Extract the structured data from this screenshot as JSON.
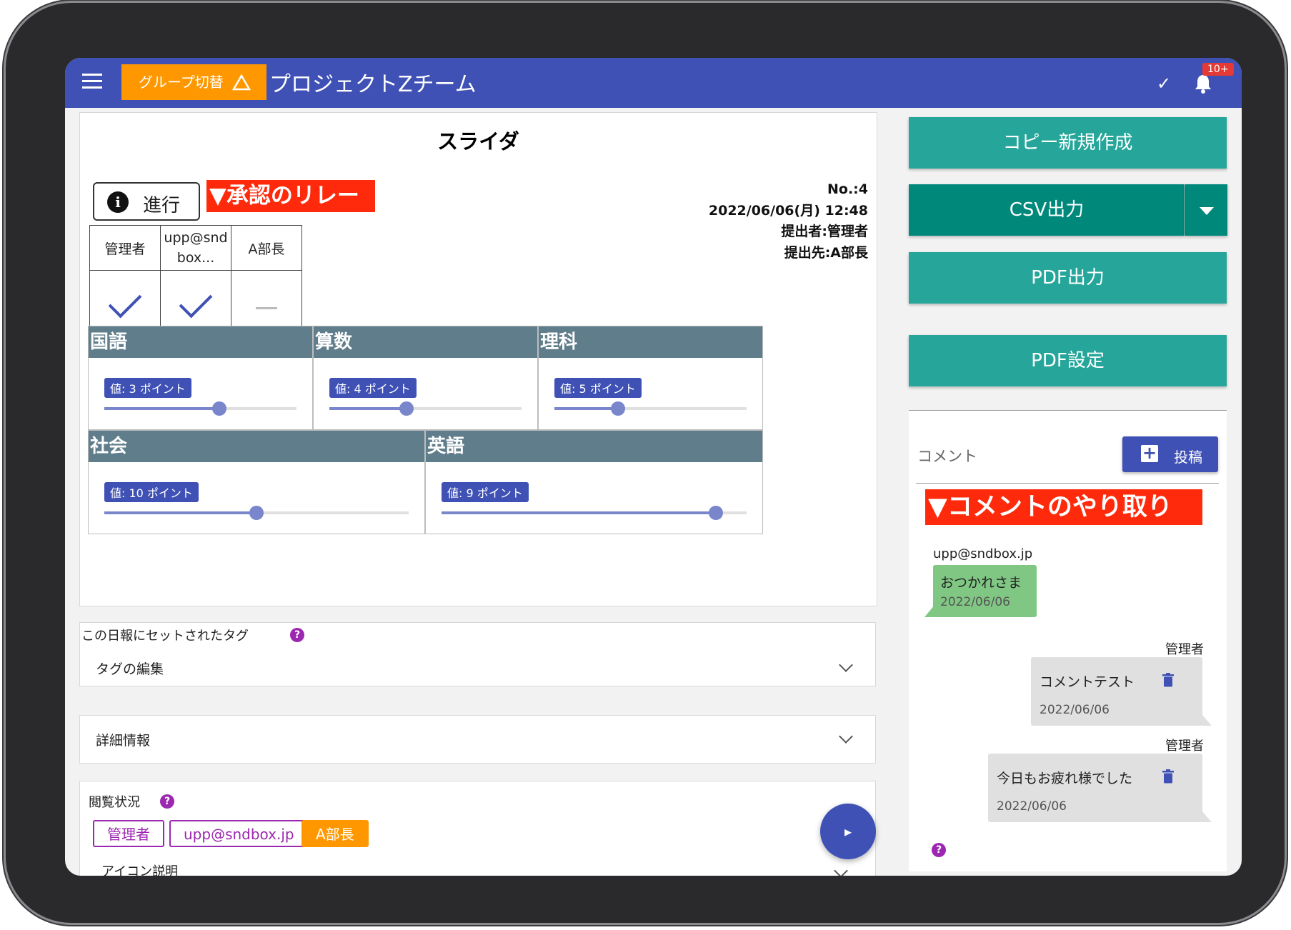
{
  "topbar": {
    "group_switch_label": "グループ切替",
    "app_title": "プロジェクトZチーム",
    "notification_badge": "10+"
  },
  "report": {
    "title": "スライダ",
    "status_label": "進行",
    "approval_annotation": "▼承認のリレー",
    "number": "No.:4",
    "datetime": "2022/06/06(月) 12:48",
    "submitter": "提出者:管理者",
    "recipient": "提出先:A部長",
    "approvers": [
      {
        "name": "管理者",
        "approved": true
      },
      {
        "name": "upp@sndbox...",
        "approved": true
      },
      {
        "name": "A部長",
        "approved": false
      }
    ],
    "subjects": [
      {
        "name": "国語",
        "value_label": "値: 3 ポイント",
        "fraction": 0.6
      },
      {
        "name": "算数",
        "value_label": "値: 4 ポイント",
        "fraction": 0.4
      },
      {
        "name": "理科",
        "value_label": "値: 5 ポイント",
        "fraction": 0.33
      },
      {
        "name": "社会",
        "value_label": "値: 10 ポイント",
        "fraction": 0.5
      },
      {
        "name": "英語",
        "value_label": "値: 9 ポイント",
        "fraction": 0.9
      }
    ]
  },
  "tags": {
    "heading": "この日報にセットされたタグ",
    "edit_label": "タグの編集"
  },
  "details": {
    "label": "詳細情報"
  },
  "views": {
    "heading": "閲覧状況",
    "readers": [
      "管理者",
      "upp@sndbox.jp",
      "A部長"
    ],
    "icon_help_label": "アイコン説明"
  },
  "actions": {
    "copy_new": "コピー新規作成",
    "csv_export": "CSV出力",
    "pdf_export": "PDF出力",
    "pdf_settings": "PDF設定"
  },
  "comments": {
    "heading": "コメント",
    "post_label": "投稿",
    "annotation": "▼コメントのやり取り",
    "items": [
      {
        "author": "upp@sndbox.jp",
        "text": "おつかれさま",
        "date": "2022/06/06"
      },
      {
        "author": "管理者",
        "text": "コメントテスト",
        "date": "2022/06/06"
      },
      {
        "author": "管理者",
        "text": "今日もお疲れ様でした",
        "date": "2022/06/06"
      }
    ]
  },
  "colors": {
    "primary": "#3f51b5",
    "accent_orange": "#ff9800",
    "teal": "#26a69a",
    "annotation_red": "#ff2a0c",
    "subject_header": "#607d8b",
    "help_purple": "#9c27b0",
    "bubble_green": "#81c784"
  }
}
